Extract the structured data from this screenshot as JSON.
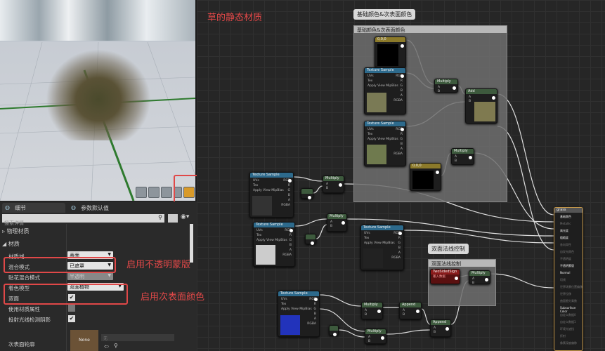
{
  "graph_title": "草的静态材质",
  "comments": [
    {
      "bubble": "基础颜色&次表面颜色",
      "header": "基础颜色&次表面颜色"
    },
    {
      "bubble": "双面法线控制",
      "header": "双面法线控制"
    }
  ],
  "nodes": [
    {
      "title": "0,0,0",
      "type": "const"
    },
    {
      "title": "Texture Sample",
      "type": "tex"
    },
    {
      "title": "Multiply",
      "type": "math"
    },
    {
      "title": "Add",
      "type": "math"
    },
    {
      "title": "Texture Sample",
      "type": "tex"
    },
    {
      "title": "Multiply",
      "type": "math"
    },
    {
      "title": "0,0,0",
      "type": "const"
    },
    {
      "title": "Texture Sample",
      "type": "tex"
    },
    {
      "title": "Multiply",
      "type": "math"
    },
    {
      "title": "",
      "type": "small"
    },
    {
      "title": "Multiply",
      "type": "math"
    },
    {
      "title": "Texture Sample",
      "type": "tex"
    },
    {
      "title": "",
      "type": "small"
    },
    {
      "title": "Texture Sample",
      "type": "tex"
    },
    {
      "title": "TwoSidedSign",
      "type": "sign",
      "subtitle": "输入数据"
    },
    {
      "title": "Multiply",
      "type": "math"
    },
    {
      "title": "Texture Sample",
      "type": "tex"
    },
    {
      "title": "Multiply",
      "type": "math"
    },
    {
      "title": "Append",
      "type": "math"
    },
    {
      "title": "Multiply",
      "type": "math"
    },
    {
      "title": "Append",
      "type": "math"
    },
    {
      "title": "",
      "type": "small"
    }
  ],
  "tex_pins": {
    "inputs": [
      "UVs",
      "Tex",
      "Apply View MipBias"
    ],
    "outputs": [
      "RGB",
      "R",
      "G",
      "B",
      "A",
      "RGBA"
    ]
  },
  "math_pins": [
    "A",
    "B"
  ],
  "material_node": {
    "title": "grass",
    "pins": [
      "基础颜色",
      "Metallic",
      "高光度",
      "粗糙度",
      "各向异性",
      "自发光颜色",
      "不透明度",
      "不透明蒙版",
      "Normal",
      "切线",
      "世界场景位置偏移",
      "世界位移",
      "曲面细分乘数",
      "Subsurface Color",
      "自定义数据0",
      "自定义数据1",
      "环境光遮挡",
      "折射",
      "像素深度偏移"
    ]
  },
  "panel": {
    "tabs": [
      "细节",
      "参数默认值"
    ],
    "search_placeholder": "搜索详情",
    "sections": [
      "物理材质",
      "材质"
    ],
    "rows": [
      {
        "label": "材质域",
        "value": "表面",
        "kind": "dropdown"
      },
      {
        "label": "混合模式",
        "value": "已遮罩",
        "kind": "dropdown"
      },
      {
        "label": "贴花混合模式",
        "value": "半透明",
        "kind": "dropdown",
        "disabled": true
      },
      {
        "label": "着色模型",
        "value": "双面植物",
        "kind": "dropdown"
      },
      {
        "label": "双面",
        "checked": true,
        "kind": "checkbox"
      },
      {
        "label": "使用材质属性",
        "checked": false,
        "kind": "checkbox"
      },
      {
        "label": "投射光线检测阴影",
        "checked": true,
        "kind": "checkbox"
      }
    ],
    "subsurface": {
      "label": "次表面轮廓",
      "thumb": "None",
      "value": "无"
    }
  },
  "annotations": [
    "启用不透明蒙版",
    "启用次表面颜色"
  ],
  "colors": {
    "annotation": "#e04848",
    "tex_header": "#2d6a8c",
    "math_header": "#3d5a3d",
    "const_header": "#8c7a2a",
    "sign_header": "#8a1a1a"
  }
}
